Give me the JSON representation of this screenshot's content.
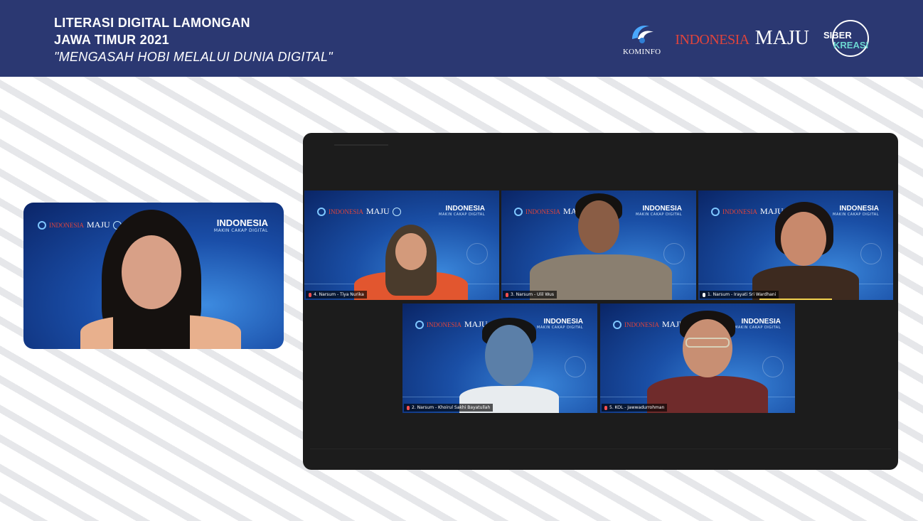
{
  "header": {
    "line1": "LITERASI DIGITAL LAMONGAN",
    "line2": "JAWA TIMUR 2021",
    "line3": "\"MENGASAH HOBI MELALUI DUNIA DIGITAL\"",
    "logos": {
      "kominfo": "KOMINFO",
      "indonesia": "INDONESIA",
      "maju": "MAJU",
      "siber": "SIBER",
      "kreasi": "KREASI"
    }
  },
  "tile_branding": {
    "indonesia": "INDONESIA",
    "tagline": "MAKIN CAKAP DIGITAL",
    "indo_small": "INDONESIA",
    "maju_small": "MAJU"
  },
  "speaker": {
    "label": ""
  },
  "participants": [
    {
      "name": "4. Narsum - Tiya Nurika",
      "muted": true
    },
    {
      "name": "3. Narsum - Ulil Wus",
      "muted": true
    },
    {
      "name": "1. Narsum - Irayati Sri Wardhani",
      "muted": false,
      "speaking": true
    },
    {
      "name": "2. Narsum - Khoirul Sakhi Bayatullah",
      "muted": true
    },
    {
      "name": "5. KOL - Jawwadurrohman",
      "muted": true
    }
  ],
  "colors": {
    "header_bg": "#2b3872",
    "indonesia_red": "#e0443c",
    "siber_teal": "#6bd6d0",
    "zoom_bg": "#1c1c1c",
    "speaking": "#f4d34e"
  }
}
